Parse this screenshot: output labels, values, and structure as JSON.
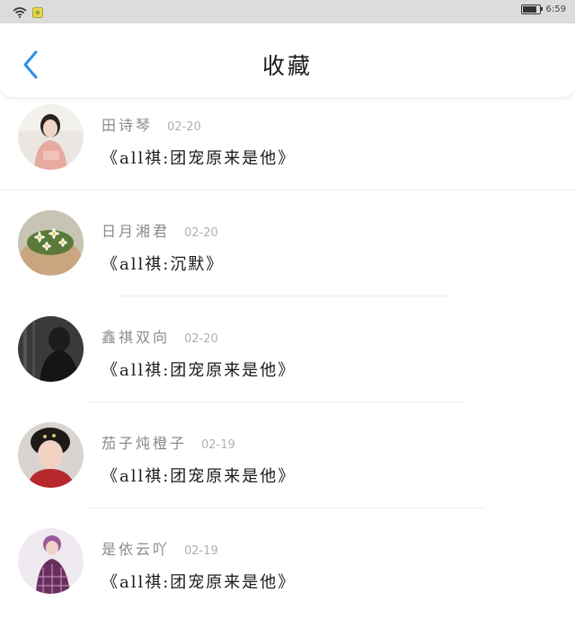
{
  "status_bar": {
    "time": "6:59",
    "battery_level": 0.85
  },
  "header": {
    "title": "收藏"
  },
  "colors": {
    "accent": "#2f8fe8",
    "title_text": "#1a1a1a",
    "author_text": "#8a8a8a",
    "date_text": "#b0b0b0"
  },
  "favorites": [
    {
      "author": "田诗琴",
      "date": "02-20",
      "title": "《all祺:团宠原来是他》"
    },
    {
      "author": "日月湘君",
      "date": "02-20",
      "title": "《all祺:沉默》"
    },
    {
      "author": "鑫祺双向",
      "date": "02-20",
      "title": "《all祺:团宠原来是他》"
    },
    {
      "author": "茄子炖橙子",
      "date": "02-19",
      "title": "《all祺:团宠原来是他》"
    },
    {
      "author": "是依云吖",
      "date": "02-19",
      "title": "《all祺:团宠原来是他》"
    }
  ]
}
